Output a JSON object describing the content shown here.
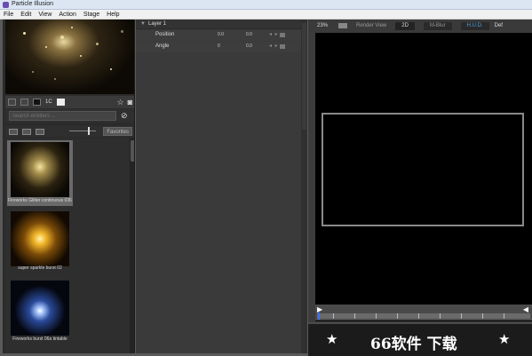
{
  "window": {
    "title": "Particle Illusion"
  },
  "menu": [
    "File",
    "Edit",
    "View",
    "Action",
    "Stage",
    "Help"
  ],
  "library": {
    "toolbar": {
      "count_label": "1C"
    },
    "search": {
      "placeholder": "Search emitters ..."
    },
    "favorites_label": "Favorites",
    "items": [
      {
        "name": "Fireworks Glitter continuous 036",
        "selected": true
      },
      {
        "name": "super sparkle burst 02",
        "selected": false
      },
      {
        "name": "Fireworks burst 06a tintable",
        "selected": false
      }
    ]
  },
  "layers": {
    "layer_name": "Layer 1",
    "properties": [
      {
        "name": "Position",
        "value1": "0.0",
        "value2": "0.0"
      },
      {
        "name": "Angle",
        "value1": "0",
        "value2": "0.0"
      }
    ]
  },
  "viewer": {
    "zoom": "23%",
    "render_view_label": "Render View",
    "mode_2d_label": "2D",
    "mblur_label": "M-Blur",
    "hud_label": "H.U.D.",
    "def_label": "Def"
  },
  "watermark": {
    "text": "66软件 下载"
  },
  "colors": {
    "hud_active": "#4aa0e0",
    "playhead": "#3b6fff",
    "app_icon": "#6a4cb3"
  }
}
